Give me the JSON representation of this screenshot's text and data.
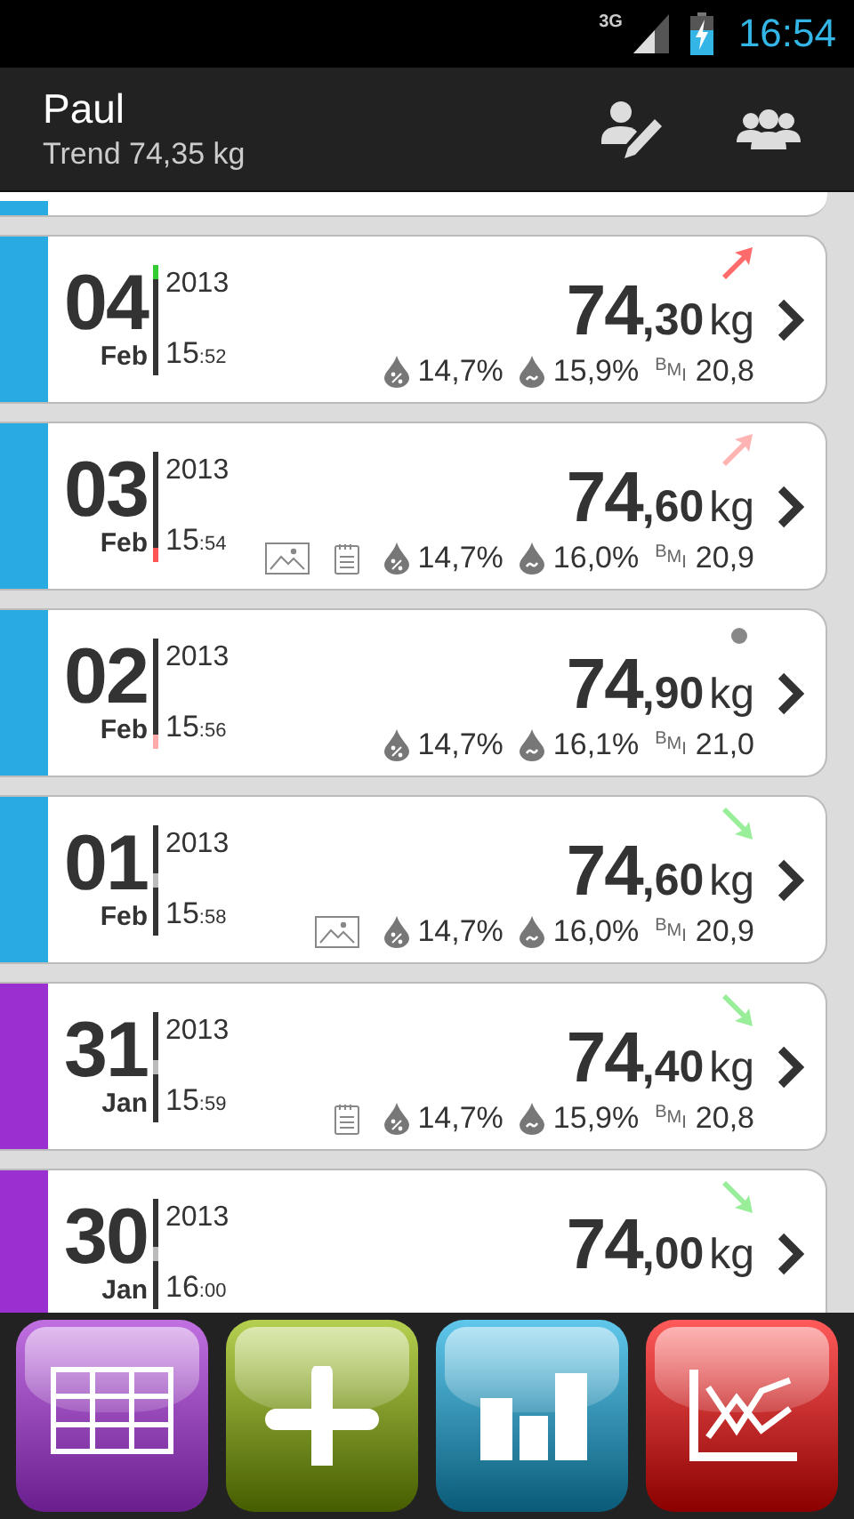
{
  "status_bar": {
    "network": "3G",
    "time": "16:54"
  },
  "header": {
    "name": "Paul",
    "subtitle": "Trend 74,35 kg"
  },
  "entries": [
    {
      "color": "#29abe2",
      "day": "04",
      "month": "Feb",
      "year": "2013",
      "hour": "15",
      "minute": ":52",
      "weight": "74",
      "decimals": ",30",
      "unit": "kg",
      "trend": {
        "kind": "up",
        "color": "#ff6b6b"
      },
      "marker": {
        "kind": "top",
        "color": "#33cc33"
      },
      "photo": false,
      "note": false,
      "fat": "14,7%",
      "water": "15,9%",
      "bmi_label": "BMI",
      "bmi": "20,8"
    },
    {
      "color": "#29abe2",
      "day": "03",
      "month": "Feb",
      "year": "2013",
      "hour": "15",
      "minute": ":54",
      "weight": "74",
      "decimals": ",60",
      "unit": "kg",
      "trend": {
        "kind": "up",
        "color": "#ffb4b4"
      },
      "marker": {
        "kind": "bottom",
        "color": "#ff5555"
      },
      "photo": true,
      "note": true,
      "fat": "14,7%",
      "water": "16,0%",
      "bmi_label": "BMI",
      "bmi": "20,9"
    },
    {
      "color": "#29abe2",
      "day": "02",
      "month": "Feb",
      "year": "2013",
      "hour": "15",
      "minute": ":56",
      "weight": "74",
      "decimals": ",90",
      "unit": "kg",
      "trend": {
        "kind": "flat",
        "color": "#888888"
      },
      "marker": {
        "kind": "bottom",
        "color": "#ffaaaa"
      },
      "photo": false,
      "note": false,
      "fat": "14,7%",
      "water": "16,1%",
      "bmi_label": "BMI",
      "bmi": "21,0"
    },
    {
      "color": "#29abe2",
      "day": "01",
      "month": "Feb",
      "year": "2013",
      "hour": "15",
      "minute": ":58",
      "weight": "74",
      "decimals": ",60",
      "unit": "kg",
      "trend": {
        "kind": "down",
        "color": "#99ee99"
      },
      "marker": {
        "kind": "middle",
        "color": "#bbbbbb"
      },
      "photo": true,
      "note": false,
      "fat": "14,7%",
      "water": "16,0%",
      "bmi_label": "BMI",
      "bmi": "20,9"
    },
    {
      "color": "#9b30d0",
      "day": "31",
      "month": "Jan",
      "year": "2013",
      "hour": "15",
      "minute": ":59",
      "weight": "74",
      "decimals": ",40",
      "unit": "kg",
      "trend": {
        "kind": "down",
        "color": "#99ee99"
      },
      "marker": {
        "kind": "middle",
        "color": "#bbbbbb"
      },
      "photo": false,
      "note": true,
      "fat": "14,7%",
      "water": "15,9%",
      "bmi_label": "BMI",
      "bmi": "20,8"
    },
    {
      "color": "#9b30d0",
      "day": "30",
      "month": "Jan",
      "year": "2013",
      "hour": "16",
      "minute": ":00",
      "weight": "74",
      "decimals": ",00",
      "unit": "kg",
      "trend": {
        "kind": "down",
        "color": "#99ee99"
      },
      "marker": {
        "kind": "middle",
        "color": "#bbbbbb"
      }
    }
  ],
  "toolbar": [
    {
      "kind": "table"
    },
    {
      "kind": "add"
    },
    {
      "kind": "bars"
    },
    {
      "kind": "graph"
    }
  ]
}
